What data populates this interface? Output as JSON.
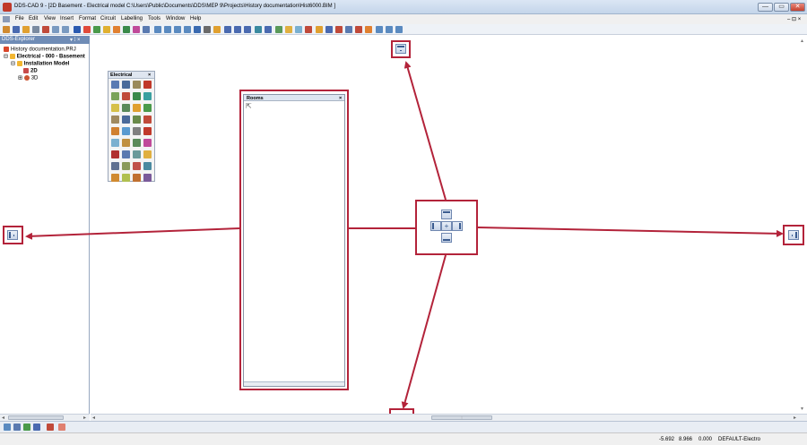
{
  "window": {
    "title": "DDS-CAD 9 - [2D Basement      - Electrical model  C:\\Users\\Public\\Documents\\DDS\\MEP 9\\Projects\\History documentation\\Hist6000.BIM ]"
  },
  "menu": [
    "File",
    "Edit",
    "View",
    "Insert",
    "Format",
    "Circuit",
    "Labelling",
    "Tools",
    "Window",
    "Help"
  ],
  "explorer": {
    "title": "DDS-Explorer",
    "pin": "▾ ⁞ ×",
    "tree": [
      {
        "label": "History documentation.PRJ",
        "color": "#d9472b",
        "bold": false
      },
      {
        "label": "Electrical - 000 - Basement",
        "color": "#f2b632",
        "bold": true
      },
      {
        "label": "Installation Model",
        "color": "#f2b632",
        "bold": true
      },
      {
        "label": "2D",
        "color": "#c84b4b",
        "bold": true
      },
      {
        "label": "3D",
        "color": "#cc5533",
        "bold": false
      }
    ]
  },
  "electrical_palette": {
    "title": "Electrical",
    "close": "×",
    "icons": [
      "#5a7bb3",
      "#4a6b9a",
      "#9a8a5a",
      "#c0392b",
      "#7aa35a",
      "#c04a3a",
      "#3a8a4a",
      "#3aa0a0",
      "#d6c04a",
      "#5a8a5a",
      "#e0a030",
      "#4a9a4a",
      "#a08a60",
      "#4a6a9a",
      "#6a8a4a",
      "#c04a3a",
      "#d08030",
      "#5a9ad0",
      "#808080",
      "#c0392b",
      "#7ab0d0",
      "#c09040",
      "#5a8a5a",
      "#c04a9a",
      "#b03030",
      "#5a7ab0",
      "#6a9a9a",
      "#e0b040",
      "#607090",
      "#8a9a5a",
      "#c0504a",
      "#4a8aa0",
      "#d08a30",
      "#b0c050",
      "#c07030",
      "#7a5a9a"
    ]
  },
  "rooms_panel": {
    "title": "Rooms",
    "close": "×",
    "cursor": "⇱"
  },
  "compass": {
    "center": "+"
  },
  "hscroll": {
    "left_arrow": "◂",
    "right_arrow": "▸",
    "thumb_grip": "⁝"
  },
  "vscroll": {
    "up_arrow": "▴",
    "down_arrow": "▾"
  },
  "status": {
    "x": "-5.692",
    "y": "8.966",
    "z": "0.000",
    "layer": "DEFAULT-Electro"
  },
  "colors": {
    "highlight": "#b3233a",
    "explorer_header": "#6f8cb6",
    "dock_icon": "#3a5b8f"
  },
  "window_buttons": [
    "—",
    "▭",
    "✕"
  ],
  "mdi_buttons": "– ⊡ ×"
}
